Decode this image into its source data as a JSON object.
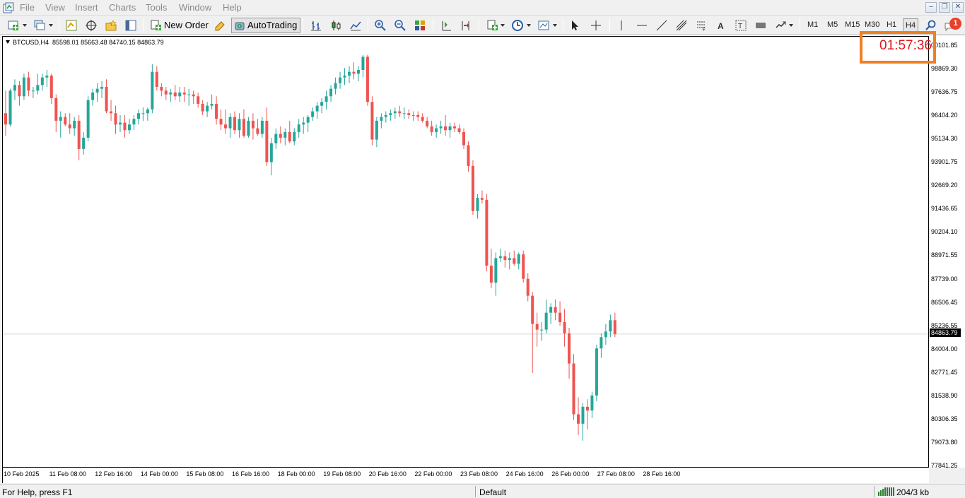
{
  "menu": {
    "items": [
      "File",
      "View",
      "Insert",
      "Charts",
      "Tools",
      "Window",
      "Help"
    ]
  },
  "toolbar": {
    "new_order_label": "New Order",
    "autotrading_label": "AutoTrading",
    "timeframes": [
      "M1",
      "M5",
      "M15",
      "M30",
      "H1",
      "H4"
    ],
    "active_timeframe": "H4",
    "notification_count": "1",
    "icons": [
      "new-chart-icon",
      "profiles-icon",
      "market-watch-icon",
      "navigator-icon",
      "favorites-icon",
      "terminal-icon",
      "new-order-icon",
      "metaeditor-icon",
      "autotrading-icon",
      "bar-chart-icon",
      "candlesticks-icon",
      "line-chart-icon",
      "zoom-in-icon",
      "zoom-out-icon",
      "tile-windows-icon",
      "auto-scroll-icon",
      "chart-shift-icon",
      "indicators-icon",
      "periods-icon",
      "templates-icon",
      "cursor-icon",
      "crosshair-icon",
      "vertical-line-icon",
      "horizontal-line-icon",
      "trendline-icon",
      "equidistant-channel-icon",
      "fibonacci-icon",
      "text-icon",
      "text-label-icon",
      "rectangle-label-icon",
      "arrows-icon",
      "search-icon",
      "chat-icon"
    ]
  },
  "chart_info": {
    "symbol": "BTCUSD,H4",
    "ohlc": "85598.01 85663.48 84740.15 84863.79"
  },
  "timer": {
    "value": "01:57:36",
    "color": "#e0181e",
    "border_color": "#f07f22"
  },
  "price_axis": {
    "labels": [
      "00101.85",
      "98869.30",
      "97636.75",
      "96404.20",
      "95134.30",
      "93901.75",
      "92669.20",
      "91436.65",
      "90204.10",
      "88971.55",
      "87739.00",
      "86506.45",
      "85236.55",
      "84004.00",
      "82771.45",
      "81538.90",
      "80306.35",
      "79073.80",
      "77841.25"
    ],
    "current_price": "84863.79"
  },
  "time_axis": {
    "labels": [
      "10 Feb 2025",
      "11 Feb 08:00",
      "12 Feb 16:00",
      "14 Feb 00:00",
      "15 Feb 08:00",
      "16 Feb 16:00",
      "18 Feb 00:00",
      "19 Feb 08:00",
      "20 Feb 16:00",
      "22 Feb 00:00",
      "23 Feb 08:00",
      "24 Feb 16:00",
      "26 Feb 00:00",
      "27 Feb 08:00",
      "28 Feb 16:00"
    ]
  },
  "status": {
    "help": "For Help, press F1",
    "profile": "Default",
    "traffic": "204/3 kb"
  },
  "colors": {
    "bull": "#26a69a",
    "bear": "#ef5350",
    "background": "#ffffff",
    "grid": "#e8e8e8"
  },
  "chart_data": {
    "type": "candlestick",
    "symbol": "BTCUSD",
    "timeframe": "H4",
    "ylim": [
      77841.25,
      100101.85
    ],
    "x_axis": "time",
    "candles": [
      [
        96600,
        97800,
        95400,
        96000
      ],
      [
        96000,
        97900,
        95900,
        97800
      ],
      [
        97800,
        98400,
        97300,
        98100
      ],
      [
        98100,
        98300,
        97000,
        97500
      ],
      [
        97500,
        98700,
        97300,
        98500
      ],
      [
        98500,
        98800,
        97500,
        97800
      ],
      [
        97800,
        98000,
        97400,
        97800
      ],
      [
        97800,
        98700,
        97600,
        98100
      ],
      [
        98100,
        98700,
        97800,
        98500
      ],
      [
        98500,
        98900,
        98000,
        98600
      ],
      [
        98600,
        98700,
        97100,
        97400
      ],
      [
        97400,
        97600,
        95600,
        96200
      ],
      [
        96200,
        96700,
        95300,
        96400
      ],
      [
        96400,
        96600,
        95900,
        96000
      ],
      [
        96000,
        96600,
        95500,
        95800
      ],
      [
        95800,
        96400,
        95400,
        96200
      ],
      [
        96200,
        96500,
        94100,
        94700
      ],
      [
        94700,
        95600,
        94400,
        95300
      ],
      [
        95300,
        97500,
        95100,
        97300
      ],
      [
        97300,
        97900,
        97000,
        97700
      ],
      [
        97700,
        98200,
        97200,
        97900
      ],
      [
        97900,
        98300,
        97400,
        98000
      ],
      [
        98000,
        98400,
        96600,
        96700
      ],
      [
        96700,
        97300,
        96200,
        96600
      ],
      [
        96600,
        97000,
        95500,
        96000
      ],
      [
        96000,
        96500,
        95600,
        96100
      ],
      [
        96100,
        96500,
        95300,
        95700
      ],
      [
        95700,
        96300,
        95500,
        96000
      ],
      [
        96000,
        96500,
        95700,
        96300
      ],
      [
        96300,
        96800,
        96000,
        96600
      ],
      [
        96600,
        96900,
        96200,
        96600
      ],
      [
        96600,
        96900,
        96200,
        96800
      ],
      [
        96800,
        99200,
        96600,
        98800
      ],
      [
        98800,
        99100,
        97800,
        98000
      ],
      [
        98000,
        98200,
        97500,
        97800
      ],
      [
        97800,
        98000,
        97300,
        97600
      ],
      [
        97600,
        97900,
        97200,
        97700
      ],
      [
        97700,
        98100,
        97300,
        97500
      ],
      [
        97500,
        98000,
        97200,
        97700
      ],
      [
        97700,
        98000,
        97200,
        97600
      ],
      [
        97600,
        97900,
        97000,
        97600
      ],
      [
        97600,
        97800,
        97100,
        97500
      ],
      [
        97500,
        97700,
        96900,
        97100
      ],
      [
        97100,
        97300,
        96500,
        96700
      ],
      [
        96700,
        97200,
        96400,
        97000
      ],
      [
        97000,
        97600,
        96800,
        97100
      ],
      [
        97100,
        97500,
        96000,
        96300
      ],
      [
        96300,
        96800,
        95700,
        96000
      ],
      [
        96000,
        96800,
        95500,
        95800
      ],
      [
        95800,
        96600,
        95300,
        96400
      ],
      [
        96400,
        96700,
        95500,
        95700
      ],
      [
        95700,
        96600,
        95300,
        96300
      ],
      [
        96300,
        96800,
        95300,
        95400
      ],
      [
        95400,
        96400,
        95300,
        96200
      ],
      [
        96200,
        96600,
        95200,
        95800
      ],
      [
        95800,
        96300,
        95400,
        95500
      ],
      [
        95500,
        96400,
        95300,
        96200
      ],
      [
        96200,
        96900,
        93800,
        94000
      ],
      [
        94000,
        95300,
        93300,
        95000
      ],
      [
        95000,
        95800,
        94700,
        95500
      ],
      [
        95500,
        95900,
        95000,
        95300
      ],
      [
        95300,
        95800,
        94900,
        95600
      ],
      [
        95600,
        96200,
        95000,
        95100
      ],
      [
        95100,
        95800,
        94900,
        95600
      ],
      [
        95600,
        96300,
        95300,
        96000
      ],
      [
        96000,
        96400,
        95500,
        96100
      ],
      [
        96100,
        96500,
        95600,
        96400
      ],
      [
        96400,
        96900,
        96200,
        96700
      ],
      [
        96700,
        97200,
        96300,
        97000
      ],
      [
        97000,
        97400,
        96600,
        97200
      ],
      [
        97200,
        97800,
        96800,
        97500
      ],
      [
        97500,
        98100,
        97200,
        97900
      ],
      [
        97900,
        98500,
        97600,
        98200
      ],
      [
        98200,
        98800,
        97900,
        98500
      ],
      [
        98500,
        99000,
        98100,
        98600
      ],
      [
        98600,
        99100,
        98200,
        98800
      ],
      [
        98800,
        99300,
        98400,
        98700
      ],
      [
        98700,
        99100,
        98300,
        98900
      ],
      [
        98900,
        99700,
        98500,
        99600
      ],
      [
        99600,
        99700,
        97000,
        97200
      ],
      [
        97200,
        97500,
        94900,
        95200
      ],
      [
        95200,
        96400,
        94800,
        96200
      ],
      [
        96200,
        96600,
        95800,
        96400
      ],
      [
        96400,
        96700,
        96100,
        96500
      ],
      [
        96500,
        96800,
        96200,
        96600
      ],
      [
        96600,
        96900,
        96300,
        96700
      ],
      [
        96700,
        97000,
        96400,
        96600
      ],
      [
        96600,
        96900,
        96300,
        96600
      ],
      [
        96600,
        96800,
        96300,
        96500
      ],
      [
        96500,
        96700,
        96200,
        96500
      ],
      [
        96500,
        96700,
        96200,
        96400
      ],
      [
        96400,
        96600,
        96100,
        96200
      ],
      [
        96200,
        96400,
        95800,
        95900
      ],
      [
        95900,
        96200,
        95400,
        95600
      ],
      [
        95600,
        96000,
        95300,
        95800
      ],
      [
        95800,
        96200,
        95500,
        95900
      ],
      [
        95900,
        96500,
        95400,
        95700
      ],
      [
        95700,
        96100,
        95300,
        95900
      ],
      [
        95900,
        96100,
        95600,
        95800
      ],
      [
        95800,
        96000,
        95500,
        95600
      ],
      [
        95600,
        95800,
        94700,
        94900
      ],
      [
        94900,
        95100,
        93500,
        93800
      ],
      [
        93800,
        94100,
        91200,
        91400
      ],
      [
        91400,
        92300,
        91000,
        92100
      ],
      [
        92100,
        92500,
        91800,
        92000
      ],
      [
        92000,
        92300,
        88200,
        88500
      ],
      [
        88500,
        89400,
        87300,
        87600
      ],
      [
        87600,
        89200,
        86900,
        88900
      ],
      [
        88900,
        89400,
        88700,
        89000
      ],
      [
        89000,
        89300,
        88400,
        88800
      ],
      [
        88800,
        89200,
        88300,
        88900
      ],
      [
        88900,
        89300,
        88500,
        88600
      ],
      [
        88600,
        89200,
        88300,
        89100
      ],
      [
        89100,
        89300,
        87600,
        87800
      ],
      [
        87800,
        88100,
        86600,
        86900
      ],
      [
        86900,
        87100,
        82800,
        85400
      ],
      [
        85400,
        86000,
        84200,
        85100
      ],
      [
        85100,
        85500,
        84500,
        85100
      ],
      [
        85100,
        86700,
        84900,
        86000
      ],
      [
        86000,
        86500,
        85400,
        86300
      ],
      [
        86300,
        86700,
        85600,
        86000
      ],
      [
        86000,
        86600,
        85300,
        85500
      ],
      [
        85500,
        86200,
        84200,
        84900
      ],
      [
        84900,
        85200,
        82500,
        83300
      ],
      [
        83300,
        83800,
        80300,
        80600
      ],
      [
        80600,
        81500,
        79500,
        80100
      ],
      [
        80100,
        81200,
        79200,
        81000
      ],
      [
        81000,
        81400,
        79800,
        80800
      ],
      [
        80800,
        81800,
        80400,
        81600
      ],
      [
        81600,
        84300,
        81300,
        84100
      ],
      [
        84100,
        84900,
        83600,
        84700
      ],
      [
        84700,
        85400,
        84300,
        85000
      ],
      [
        85000,
        85900,
        84700,
        85600
      ],
      [
        85600,
        86000,
        84700,
        84860
      ]
    ]
  }
}
